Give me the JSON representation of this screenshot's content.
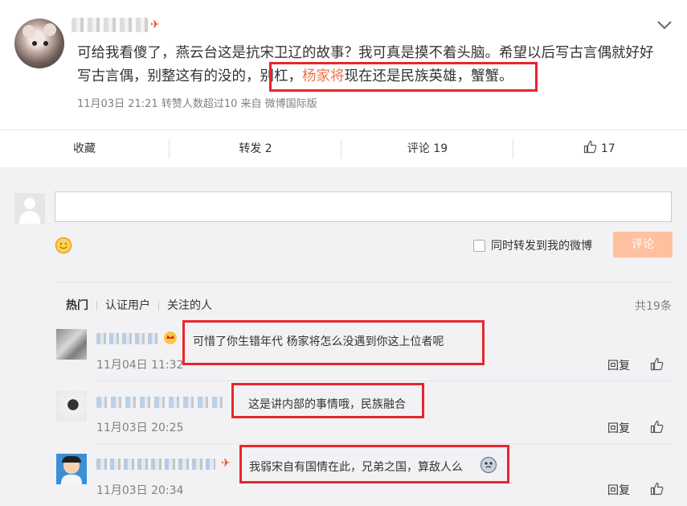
{
  "post": {
    "author_badge": "✈",
    "text_part1": "可给我看傻了，燕云台这是抗宋卫辽的故事？我可真是摸不着头脑。希望以后写古言偶就好好写古言偶，别整这有的没的，",
    "text_part2": "别杠，",
    "text_highlight": "杨家将",
    "text_part3": "现在还是民族英雄，蟹蟹。",
    "meta": "11月03日 21:21 转赞人数超过10 来自 微博国际版"
  },
  "actions": {
    "favorite": "收藏",
    "repost": "转发 2",
    "comment": "评论 19",
    "like_count": "17"
  },
  "composer": {
    "repost_label": "同时转发到我的微博",
    "submit_label": "评论"
  },
  "comments": {
    "tabs": [
      "热门",
      "认证用户",
      "关注的人"
    ],
    "total": "共19条",
    "reply_label": "回复",
    "items": [
      {
        "text": "可惜了你生错年代 杨家将怎么没遇到你这上位者呢",
        "time": "11月04日 11:32"
      },
      {
        "text": "这是讲内部的事情哦，民族融合",
        "time": "11月03日 20:25"
      },
      {
        "text": "我弱宋自有国情在此，兄弟之国，算敌人么",
        "time": "11月03日 20:34"
      }
    ]
  },
  "icons": {
    "more": "chevron-down-icon",
    "like": "thumbs-up-icon",
    "emoji": "smiley-icon",
    "crown": "crown-icon"
  },
  "colors": {
    "accent": "#eb7350",
    "annotation": "#e8262b",
    "submit_disabled": "#ffc09f"
  }
}
